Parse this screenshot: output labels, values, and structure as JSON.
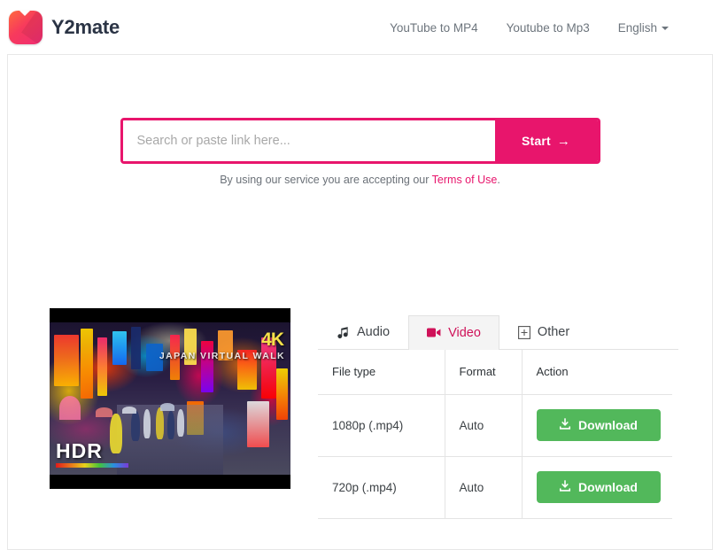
{
  "header": {
    "brand_name": "Y2mate",
    "logo_icon": "download-arrow-icon",
    "nav": [
      {
        "label": "YouTube to MP4"
      },
      {
        "label": "Youtube to Mp3"
      },
      {
        "label": "English",
        "has_caret": true
      }
    ]
  },
  "search": {
    "placeholder": "Search or paste link here...",
    "value": "",
    "start_label": "Start",
    "start_arrow": "→",
    "terms_prefix": "By using our service you are accepting our ",
    "terms_link": "Terms of Use",
    "terms_suffix": "."
  },
  "thumbnail": {
    "badge_4k": "4K",
    "badge_title": "JAPAN VIRTUAL WALK",
    "badge_hdr": "HDR"
  },
  "tabs": [
    {
      "label": "Audio",
      "icon": "music-note-icon",
      "active": false
    },
    {
      "label": "Video",
      "icon": "video-camera-icon",
      "active": true
    },
    {
      "label": "Other",
      "icon": "plus-box-icon",
      "active": false
    }
  ],
  "table": {
    "columns": [
      "File type",
      "Format",
      "Action"
    ],
    "rows": [
      {
        "file_type": "1080p (.mp4)",
        "format": "Auto",
        "action_label": "Download"
      },
      {
        "file_type": "720p (.mp4)",
        "format": "Auto",
        "action_label": "Download"
      }
    ]
  },
  "colors": {
    "accent_pink": "#e8156c",
    "tab_active_text": "#cf1259",
    "download_green": "#52b85b",
    "brand_text": "#2b3445"
  }
}
